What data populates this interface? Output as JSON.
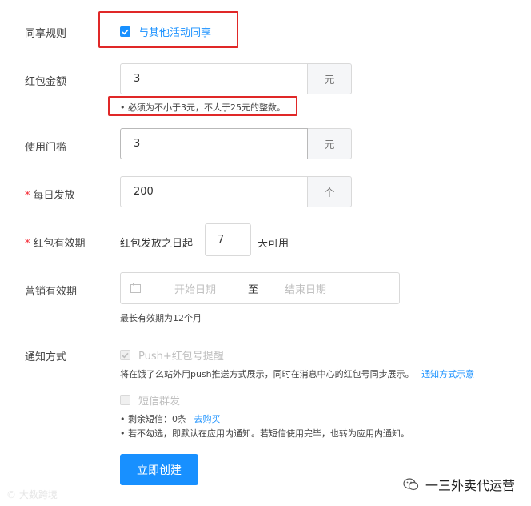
{
  "rule": {
    "label": "同享规则",
    "checkbox_label": "与其他活动同享",
    "checked": true
  },
  "amount": {
    "label": "红包金额",
    "value": "3",
    "unit": "元",
    "hint": "• 必须为不小于3元，不大于25元的整数。"
  },
  "threshold": {
    "label": "使用门槛",
    "value": "3",
    "unit": "元"
  },
  "daily": {
    "required_mark": "*",
    "label": "每日发放",
    "value": "200",
    "unit": "个"
  },
  "validity": {
    "required_mark": "*",
    "label": "红包有效期",
    "prefix": "红包发放之日起",
    "value": "7",
    "suffix": "天可用"
  },
  "marketing": {
    "label": "营销有效期",
    "start_placeholder": "开始日期",
    "separator": "至",
    "end_placeholder": "结束日期",
    "hint": "最长有效期为12个月"
  },
  "notify": {
    "label": "通知方式",
    "push_label": "Push+红包号提醒",
    "push_desc": "将在饿了么站外用push推送方式展示，同时在消息中心的红包号同步展示。",
    "push_link": "通知方式示意",
    "sms_label": "短信群发",
    "sms_remaining": "• 剩余短信：0条",
    "sms_buy_link": "去购买",
    "sms_note": "• 若不勾选，即默认在应用内通知。若短信使用完毕，也转为应用内通知。"
  },
  "submit_label": "立即创建",
  "watermark_left": "© 大数跨境",
  "watermark_right": "一三外卖代运营",
  "colors": {
    "primary": "#1890ff",
    "highlight_box": "#e02828",
    "required": "#f5222d"
  }
}
